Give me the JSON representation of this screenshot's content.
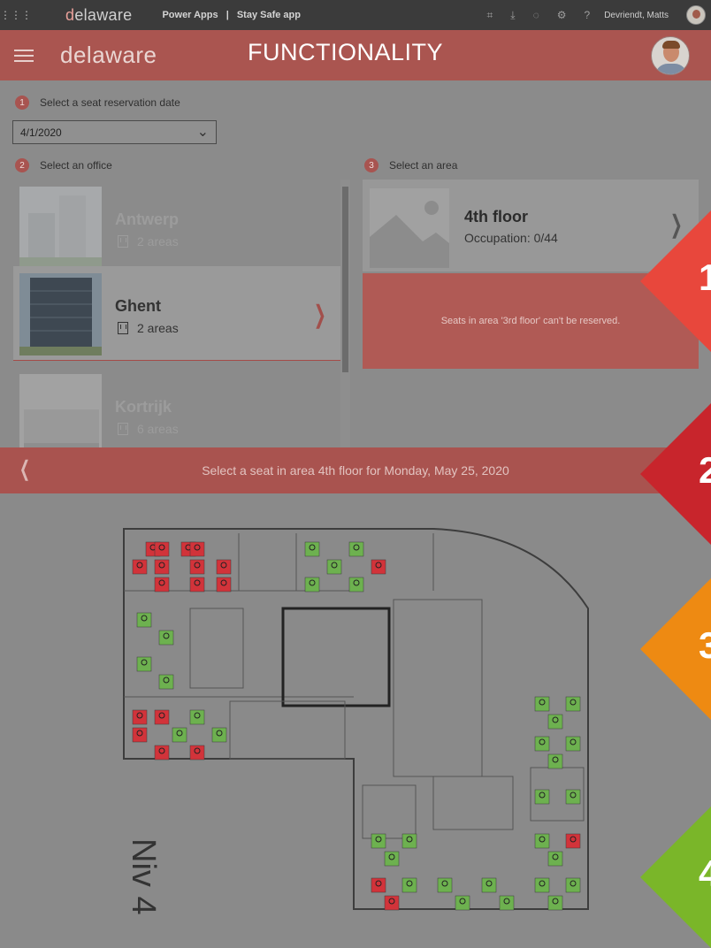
{
  "topbar": {
    "brand": "delaware",
    "product": "Power Apps",
    "separator": "|",
    "app_name": "Stay Safe app",
    "user_name": "Devriendt, Matts"
  },
  "header": {
    "brand": "delaware",
    "overlay_title": "FUNCTIONALITY"
  },
  "steps": [
    {
      "number": "1",
      "label": "Select a seat reservation date"
    },
    {
      "number": "2",
      "label": "Select an office"
    },
    {
      "number": "3",
      "label": "Select an area"
    }
  ],
  "date_picker": {
    "value": "4/1/2020"
  },
  "offices": [
    {
      "name": "Antwerp",
      "areas": "2 areas",
      "selected": false
    },
    {
      "name": "Ghent",
      "areas": "2 areas",
      "selected": true
    },
    {
      "name": "Kortrijk",
      "areas": "6 areas",
      "selected": false
    }
  ],
  "areas": [
    {
      "name": "4th floor",
      "occupation": "Occupation: 0/44"
    },
    {
      "name": "3rd floor",
      "message": "Seats in area '3rd floor' can't be reserved."
    }
  ],
  "seat_bar": {
    "title": "Select a seat in area 4th floor for Monday, May 25, 2020"
  },
  "floorplan": {
    "label": "Niv 4"
  },
  "callouts": [
    {
      "label": "1",
      "color": "#e8473c"
    },
    {
      "label": "2",
      "color": "#c8252c"
    },
    {
      "label": "3",
      "color": "#ee8a12"
    },
    {
      "label": "4",
      "color": "#7ab629"
    }
  ],
  "colors": {
    "seat_available": "#6db14f",
    "seat_occupied": "#d2333a",
    "brand_red": "#a9534f"
  }
}
